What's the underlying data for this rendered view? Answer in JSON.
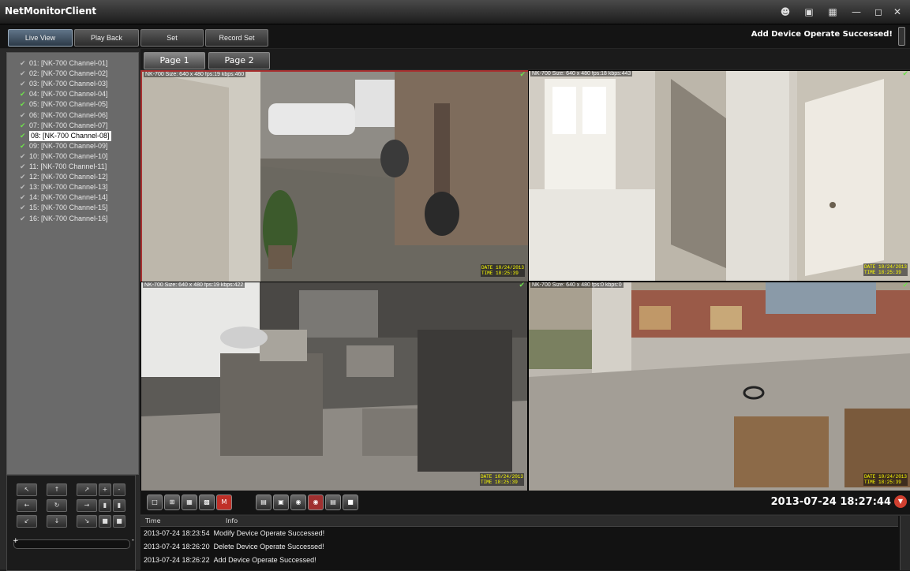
{
  "window": {
    "title": "NetMonitorClient",
    "controls": [
      "users-icon",
      "monitor-icon",
      "restore-icon",
      "minimize-icon",
      "maximize-icon",
      "close-icon"
    ]
  },
  "toolbar": {
    "buttons": [
      "Live View",
      "Play Back",
      "Set",
      "Record Set"
    ],
    "status": "Add Device Operate Successed!"
  },
  "channels": [
    {
      "label": "01: [NK-700 Channel-01]",
      "on": false
    },
    {
      "label": "02: [NK-700 Channel-02]",
      "on": false
    },
    {
      "label": "03: [NK-700 Channel-03]",
      "on": false
    },
    {
      "label": "04: [NK-700 Channel-04]",
      "on": true
    },
    {
      "label": "05: [NK-700 Channel-05]",
      "on": true
    },
    {
      "label": "06: [NK-700 Channel-06]",
      "on": false
    },
    {
      "label": "07: [NK-700 Channel-07]",
      "on": true
    },
    {
      "label": "08: [NK-700 Channel-08]",
      "on": true,
      "selected": true
    },
    {
      "label": "09: [NK-700 Channel-09]",
      "on": true
    },
    {
      "label": "10: [NK-700 Channel-10]",
      "on": false
    },
    {
      "label": "11: [NK-700 Channel-11]",
      "on": false
    },
    {
      "label": "12: [NK-700 Channel-12]",
      "on": false
    },
    {
      "label": "13: [NK-700 Channel-13]",
      "on": false
    },
    {
      "label": "14: [NK-700 Channel-14]",
      "on": false
    },
    {
      "label": "15: [NK-700 Channel-15]",
      "on": false
    },
    {
      "label": "16: [NK-700 Channel-16]",
      "on": false
    }
  ],
  "pages": [
    "Page 1",
    "Page 2"
  ],
  "cameras": [
    {
      "info": "NK-700 Size: 640 x 480 fps:19 kbps:460",
      "osd_date": "DATE 10/24/2013",
      "osd_time": "TIME 18:25:39",
      "active": true
    },
    {
      "info": "NK-700 Size: 640 x 480 fps:18 kbps:443",
      "osd_date": "DATE 10/24/2013",
      "osd_time": "TIME 18:25:39",
      "active": false
    },
    {
      "info": "NK-700 Size: 640 x 480 fps:19 kbps:422",
      "osd_date": "DATE 10/24/2013",
      "osd_time": "TIME 18:25:39",
      "active": false
    },
    {
      "info": "NK-700 Size: 640 x 480 fps:0 kbps:0",
      "osd_date": "DATE 10/24/2013",
      "osd_time": "TIME 18:25:39",
      "active": false
    }
  ],
  "clock": "2013-07-24 18:27:44",
  "log": {
    "columns": [
      "Time",
      "Info"
    ],
    "rows": [
      {
        "time": "2013-07-24 18:23:54",
        "info": "Modify Device Operate Successed!"
      },
      {
        "time": "2013-07-24 18:26:20",
        "info": "Delete Device Operate Successed!"
      },
      {
        "time": "2013-07-24 18:26:22",
        "info": "Add Device Operate Successed!"
      }
    ]
  },
  "colors": {
    "active_border": "#a83030",
    "check_on": "#6fe04c",
    "osd": "#ffff00"
  }
}
